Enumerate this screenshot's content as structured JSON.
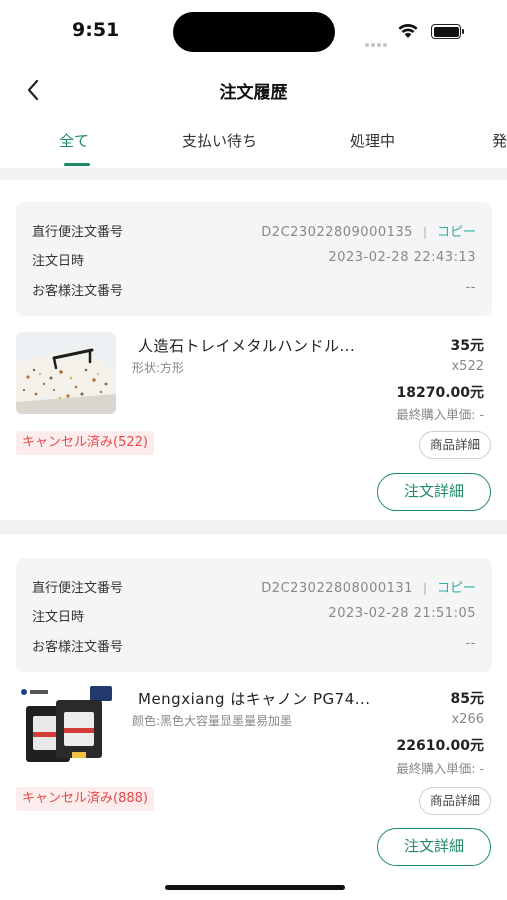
{
  "status_bar": {
    "time": "9:51"
  },
  "header": {
    "title": "注文履歴"
  },
  "tabs": [
    {
      "label": "全て"
    },
    {
      "label": "支払い待ち"
    },
    {
      "label": "処理中"
    },
    {
      "label": "発"
    }
  ],
  "colors": {
    "accent": "#1e8a6a",
    "copy": "#2bb0a8",
    "cancel": "#e54b4b"
  },
  "orders": [
    {
      "order_no_label": "直行便注文番号",
      "order_no": "D2C23022809000135",
      "separator": "|",
      "copy_label": "コピー",
      "date_label": "注文日時",
      "date": "2023-02-28 22:43:13",
      "customer_no_label": "お客様注文番号",
      "customer_no": "--",
      "product": {
        "name": "人造石トレイメタルハンドル...",
        "variant": "形状:方形",
        "price": "35元",
        "qty": "x522",
        "total": "18270.00元",
        "last_price": "最終購入単価: -"
      },
      "status": "キャンセル済み(522)",
      "product_detail_label": "商品詳細",
      "order_detail_label": "注文詳細"
    },
    {
      "order_no_label": "直行便注文番号",
      "order_no": "D2C23022808000131",
      "separator": "|",
      "copy_label": "コピー",
      "date_label": "注文日時",
      "date": "2023-02-28 21:51:05",
      "customer_no_label": "お客様注文番号",
      "customer_no": "--",
      "product": {
        "name": "Mengxiang はキャノン PG74...",
        "variant": "颜色:黑色大容量显墨量易加墨",
        "price": "85元",
        "qty": "x266",
        "total": "22610.00元",
        "last_price": "最終購入単価: -"
      },
      "status": "キャンセル済み(888)",
      "product_detail_label": "商品詳細",
      "order_detail_label": "注文詳細"
    }
  ]
}
